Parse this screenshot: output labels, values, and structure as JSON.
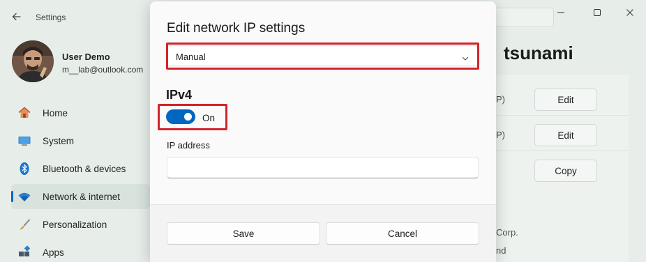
{
  "window": {
    "app_title": "Settings",
    "page_heading": "tsunami"
  },
  "profile": {
    "name": "User Demo",
    "email": "m__lab@outlook.com"
  },
  "sidebar": {
    "items": [
      {
        "label": "Home",
        "icon": "home-icon"
      },
      {
        "label": "System",
        "icon": "monitor-icon"
      },
      {
        "label": "Bluetooth & devices",
        "icon": "bluetooth-icon"
      },
      {
        "label": "Network & internet",
        "icon": "wifi-icon",
        "active": true
      },
      {
        "label": "Personalization",
        "icon": "brush-icon"
      },
      {
        "label": "Apps",
        "icon": "apps-icon"
      }
    ]
  },
  "background_panel": {
    "row_suffixes": [
      "P)",
      "P)"
    ],
    "edit_label_1": "Edit",
    "edit_label_2": "Edit",
    "copy_label": "Copy",
    "corp_text": "Corp.",
    "nd_text": "nd"
  },
  "dialog": {
    "title": "Edit network IP settings",
    "mode_select": {
      "value": "Manual"
    },
    "ipv4": {
      "section_title": "IPv4",
      "toggle_label": "On",
      "toggle_on": true
    },
    "ip_address": {
      "label": "IP address",
      "value": ""
    },
    "save_label": "Save",
    "cancel_label": "Cancel"
  },
  "colors": {
    "accent": "#0067c0",
    "highlight": "#d2232a"
  }
}
